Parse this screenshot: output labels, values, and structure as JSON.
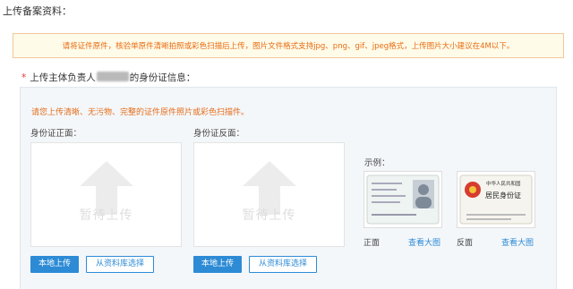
{
  "section_title": "上传备案资料：",
  "notice": "请将证件原件，核验单原件清晰拍照或彩色扫描后上传，图片文件格式支持jpg、png、gif、jpeg格式，上传图片大小建议在4M以下。",
  "upload_heading": {
    "required_mark": "*",
    "prefix": "上传主体负责人",
    "suffix": "的身份证信息："
  },
  "tip": "请您上传清晰、无污物、完整的证件原件照片或彩色扫描件。",
  "front": {
    "label": "身份证正面：",
    "placeholder": "暂待上传",
    "upload_button": "本地上传",
    "library_button": "从资料库选择"
  },
  "back": {
    "label": "身份证反面：",
    "placeholder": "暂待上传",
    "upload_button": "本地上传",
    "library_button": "从资料库选择"
  },
  "samples": {
    "title": "示例：",
    "front_caption": "正面",
    "back_caption": "反面",
    "view_large": "查看大图",
    "back_card_header": "中华人民共和国",
    "back_card_title": "居民身份证"
  },
  "colors": {
    "accent": "#2d8bd6",
    "notice_text": "#e86c12",
    "notice_border": "#f3c79a",
    "required": "#ee3333"
  },
  "icons": {
    "upload": "upload-arrow-icon",
    "emblem": "national-emblem-icon",
    "portrait": "portrait-photo-icon"
  }
}
